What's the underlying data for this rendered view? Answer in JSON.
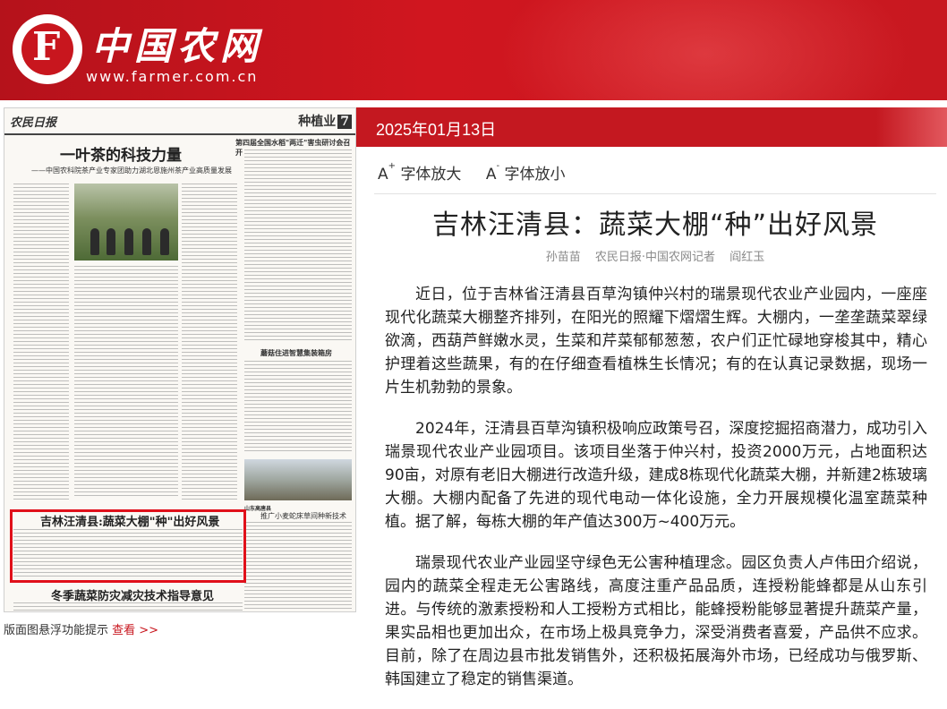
{
  "header": {
    "logo_letter": "F",
    "site_name": "中国农网",
    "site_url": "www.farmer.com.cn",
    "brand_color": "#c8161e"
  },
  "paper": {
    "masthead": "农民日报",
    "section": "种植业",
    "page_number": "7",
    "headlines": [
      "一叶茶的科技力量",
      "——中国农科院茶产业专家团助力湖北恩施州茶产业高质量发展",
      "第四届全国水稻\"两迁\"害虫研讨会召开",
      "蘑菇住进智慧集装箱房",
      "推广小麦蛇床草间种新技术",
      "山东高唐县"
    ],
    "highlighted_headline": "吉林汪清县:蔬菜大棚\"种\"出好风景",
    "second_headline": "冬季蔬菜防灾减灾技术指导意见",
    "hint_text": "版面图悬浮功能提示",
    "hint_link": "查看 >>"
  },
  "article": {
    "date": "2025年01月13日",
    "font_larger": "字体放大",
    "font_smaller": "字体放小",
    "title": "吉林汪清县：蔬菜大棚“种”出好风景",
    "byline_reporter": "孙苗苗",
    "byline_source": "农民日报·中国农网记者",
    "byline_reporter2": "阎红玉",
    "paragraphs": [
      "近日，位于吉林省汪清县百草沟镇仲兴村的瑞景现代农业产业园内，一座座现代化蔬菜大棚整齐排列，在阳光的照耀下熠熠生辉。大棚内，一垄垄蔬菜翠绿欲滴，西葫芦鲜嫩水灵，生菜和芹菜郁郁葱葱，农户们正忙碌地穿梭其中，精心护理着这些蔬果，有的在仔细查看植株生长情况；有的在认真记录数据，现场一片生机勃勃的景象。",
      "2024年，汪清县百草沟镇积极响应政策号召，深度挖掘招商潜力，成功引入瑞景现代农业产业园项目。该项目坐落于仲兴村，投资2000万元，占地面积达90亩，对原有老旧大棚进行改造升级，建成8栋现代化蔬菜大棚，并新建2栋玻璃大棚。大棚内配备了先进的现代电动一体化设施，全力开展规模化温室蔬菜种植。据了解，每栋大棚的年产值达300万~400万元。",
      "瑞景现代农业产业园坚守绿色无公害种植理念。园区负责人卢伟田介绍说，园内的蔬菜全程走无公害路线，高度注重产品品质，连授粉能蜂都是从山东引进。与传统的激素授粉和人工授粉方式相比，能蜂授粉能够显著提升蔬菜产量，果实品相也更加出众，在市场上极具竞争力，深受消费者喜爱，产品供不应求。目前，除了在周边县市批发销售外，还积极拓展海外市场，已经成功与俄罗斯、韩国建立了稳定的销售渠道。"
    ]
  }
}
